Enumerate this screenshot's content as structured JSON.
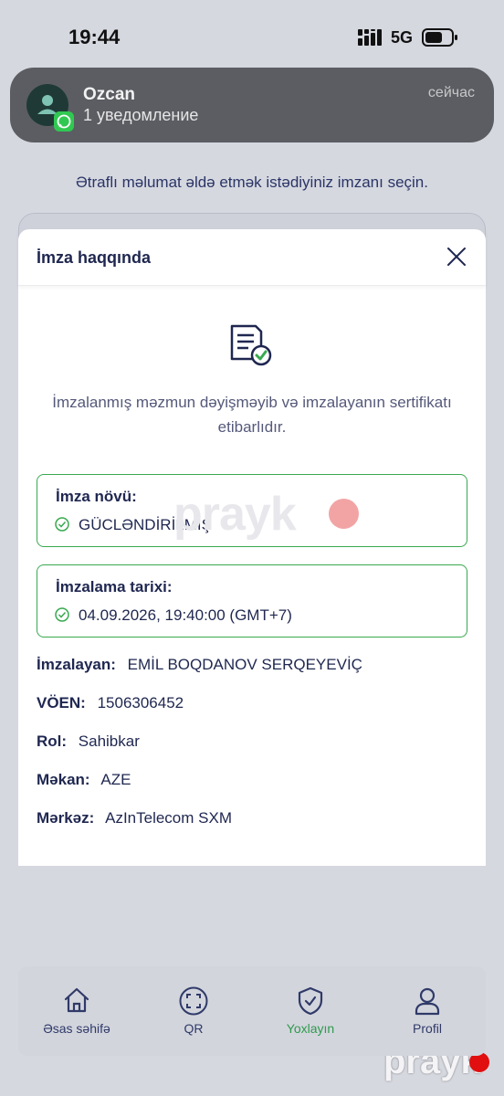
{
  "status_bar": {
    "time": "19:44",
    "network": "5G"
  },
  "notification": {
    "sender": "Ozcan",
    "body": "1 уведомление",
    "time": "сейчас"
  },
  "background": {
    "instruction": "Ətraflı məlumat əldə etmək istədiyiniz imzanı seçin."
  },
  "modal": {
    "title": "İmza haqqında",
    "message": "İmzalanmış məzmun dəyişməyib və imzalayanın sertifikatı etibarlıdır.",
    "signature_type": {
      "label": "İmza növü:",
      "value": "GÜCLƏNDİRİLMİŞ"
    },
    "signing_date": {
      "label": "İmzalama tarixi:",
      "value": "04.09.2026, 19:40:00 (GMT+7)"
    },
    "details": {
      "signer_label": "İmzalayan:",
      "signer_value": "EMİL BOQDANOV SERQEYEVİÇ",
      "voen_label": "VÖEN:",
      "voen_value": "1506306452",
      "role_label": "Rol:",
      "role_value": "Sahibkar",
      "location_label": "Məkan:",
      "location_value": "AZE",
      "center_label": "Mərkəz:",
      "center_value": "AzInTelecom SXM"
    }
  },
  "watermark": {
    "text": "prayk"
  },
  "nav": {
    "items": [
      {
        "label": "Əsas səhifə",
        "icon": "home-icon"
      },
      {
        "label": "QR",
        "icon": "qr-scan-icon"
      },
      {
        "label": "Yoxlayın",
        "icon": "shield-check-icon"
      },
      {
        "label": "Profil",
        "icon": "user-icon"
      }
    ],
    "active": "Yoxlayın"
  },
  "colors": {
    "accent_green": "#39a950",
    "text_navy": "#1f2750",
    "watermark_red": "#e10f0f"
  }
}
